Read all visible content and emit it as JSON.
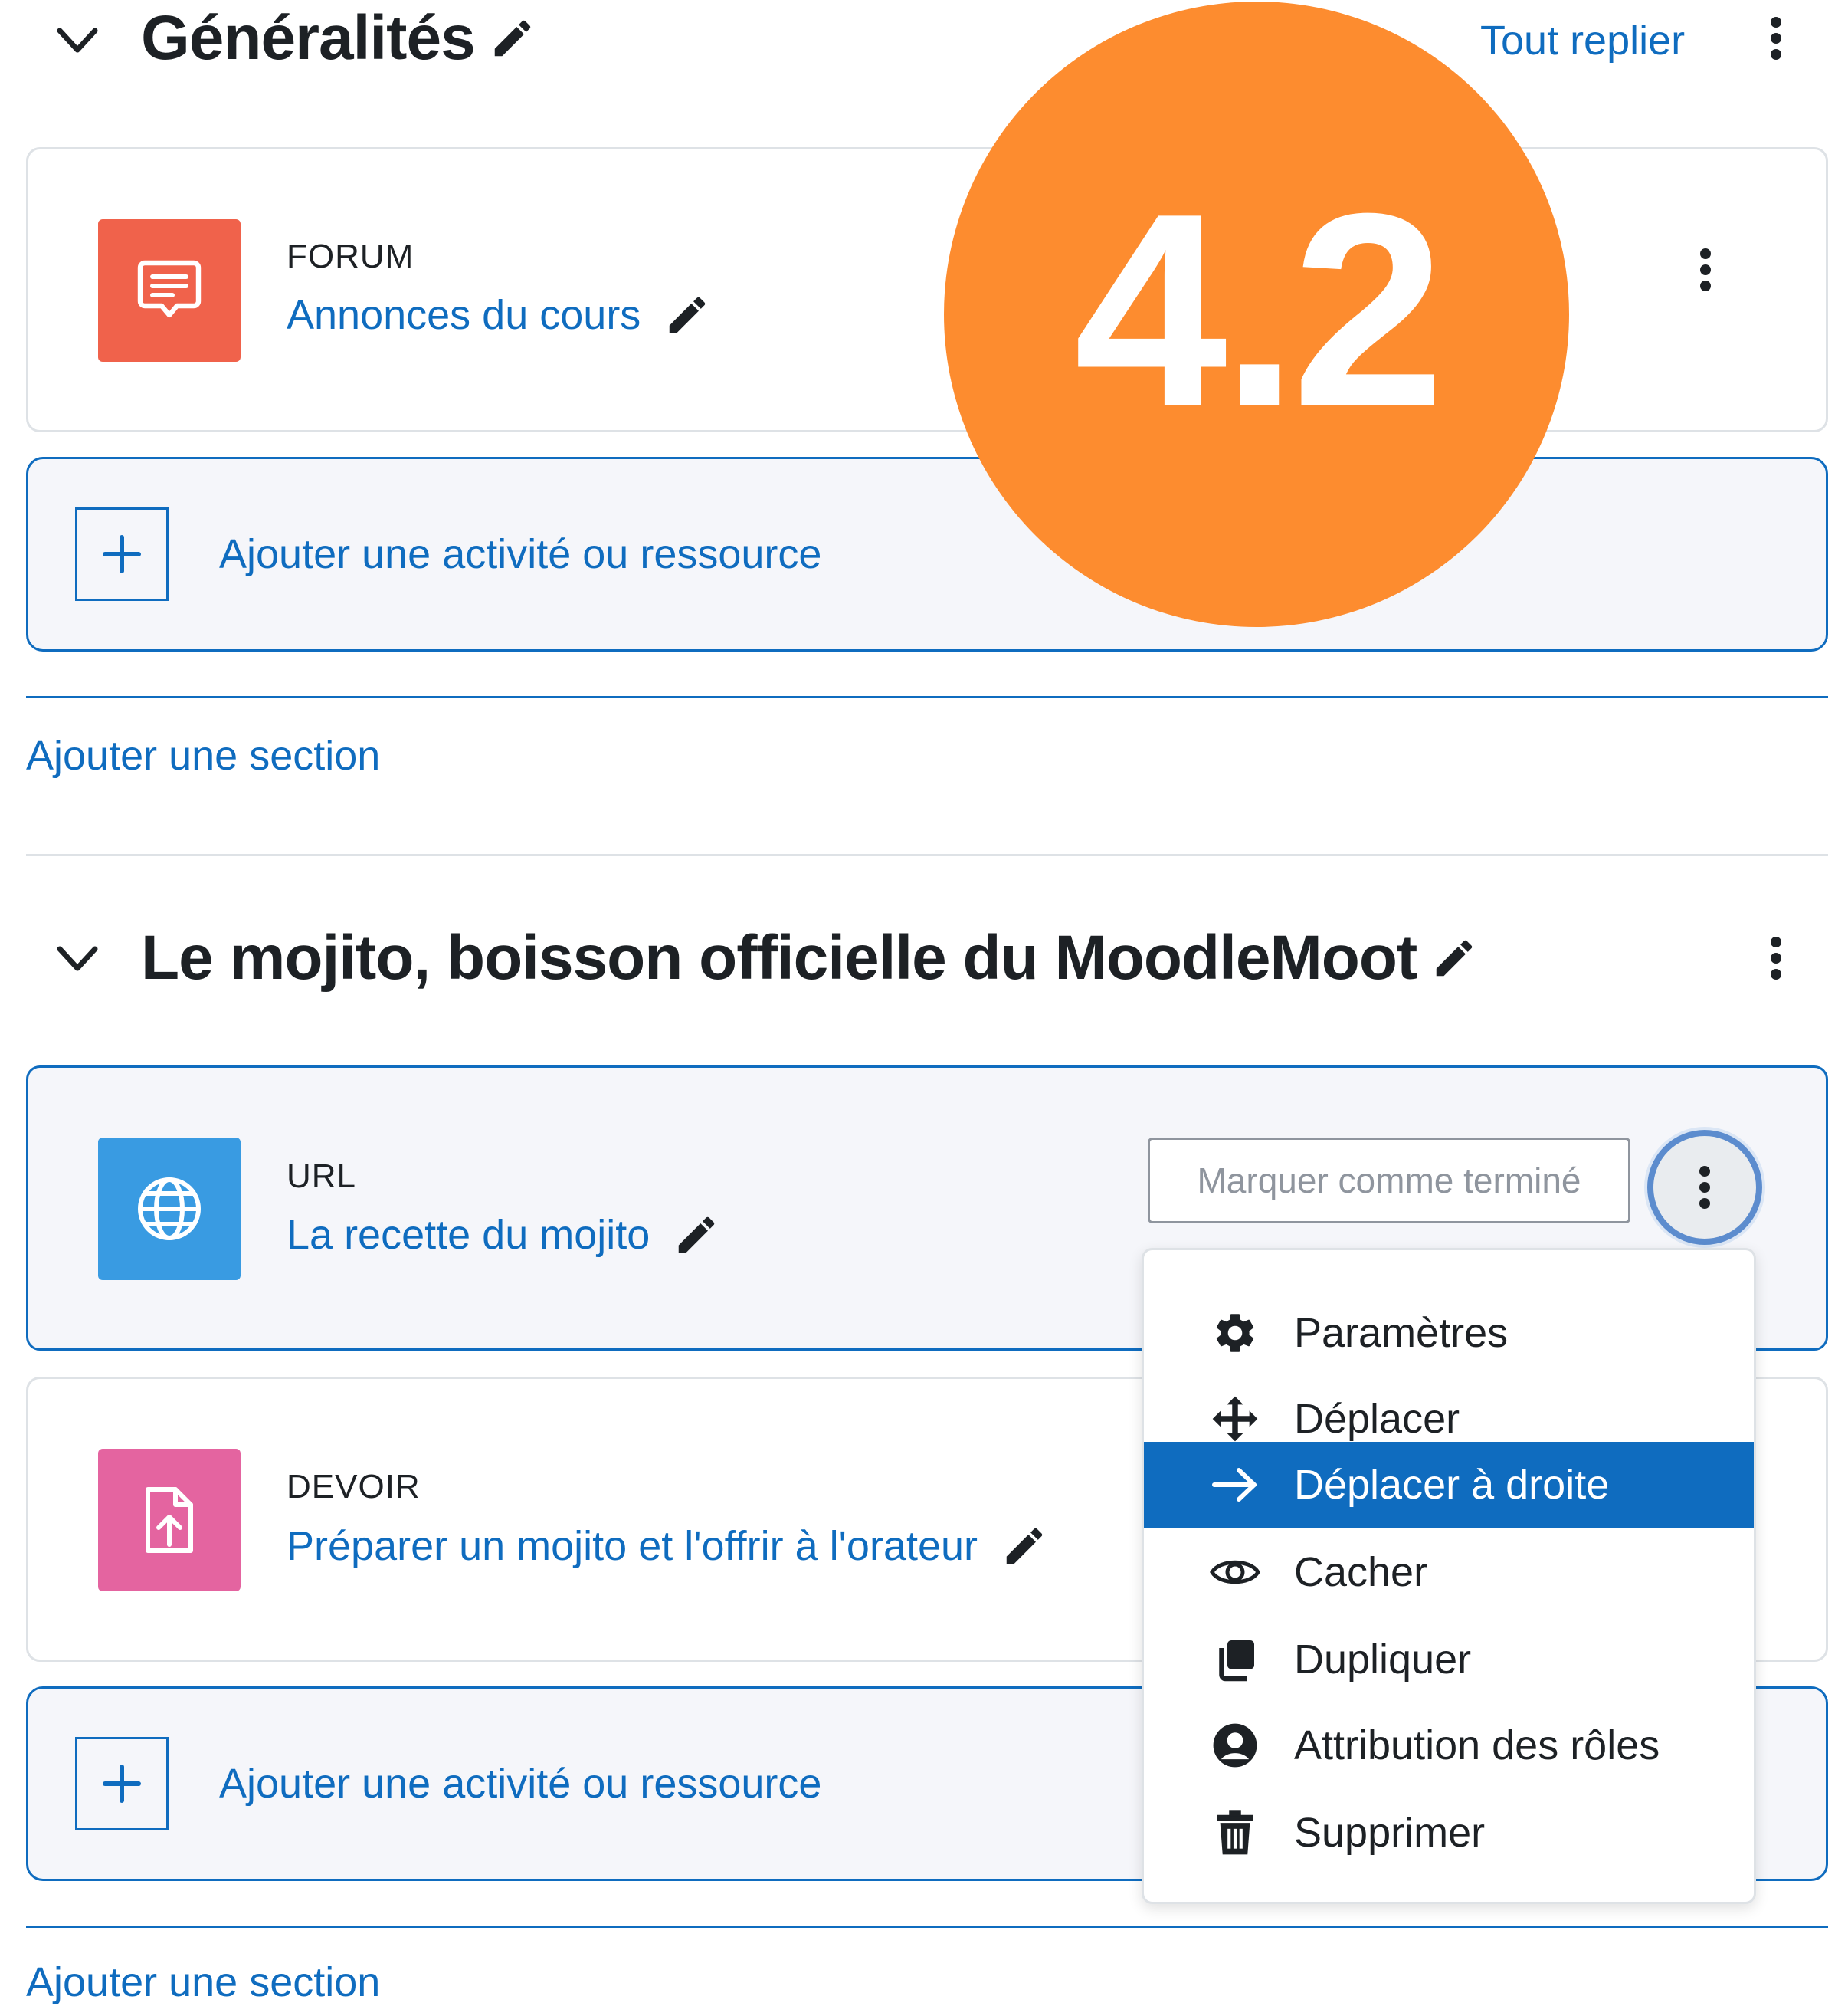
{
  "section1": {
    "title": "Généralités",
    "collapse_all": "Tout replier"
  },
  "section1_activities": [
    {
      "type": "FORUM",
      "name": "Annonces du cours",
      "icon": "forum-icon",
      "color": "#f0624b"
    }
  ],
  "add_activity_label": "Ajouter une activité ou ressource",
  "add_section_label": "Ajouter une section",
  "version_badge": "4.2",
  "section2": {
    "title": "Le mojito, boisson officielle du MoodleMoot"
  },
  "section2_activities": [
    {
      "type": "URL",
      "name": "La recette du mojito",
      "icon": "globe-icon",
      "color": "#399be2",
      "completion_button": "Marquer comme terminé"
    },
    {
      "type": "DEVOIR",
      "name": "Préparer un mojito et l'offrir à l'orateur",
      "icon": "assignment-upload-icon",
      "color": "#e464a0"
    }
  ],
  "action_menu": {
    "items": [
      {
        "label": "Paramètres",
        "icon": "gear-icon"
      },
      {
        "label": "Déplacer",
        "icon": "move-icon"
      },
      {
        "label": "Déplacer à droite",
        "icon": "arrow-right-icon",
        "active": true
      },
      {
        "label": "Cacher",
        "icon": "eye-icon"
      },
      {
        "label": "Dupliquer",
        "icon": "duplicate-icon"
      },
      {
        "label": "Attribution des rôles",
        "icon": "user-circle-icon"
      },
      {
        "label": "Supprimer",
        "icon": "trash-icon"
      }
    ]
  },
  "colors": {
    "link": "#0f6cbf",
    "badge": "#fd8c2f",
    "menu_active": "#0f6cbf"
  }
}
